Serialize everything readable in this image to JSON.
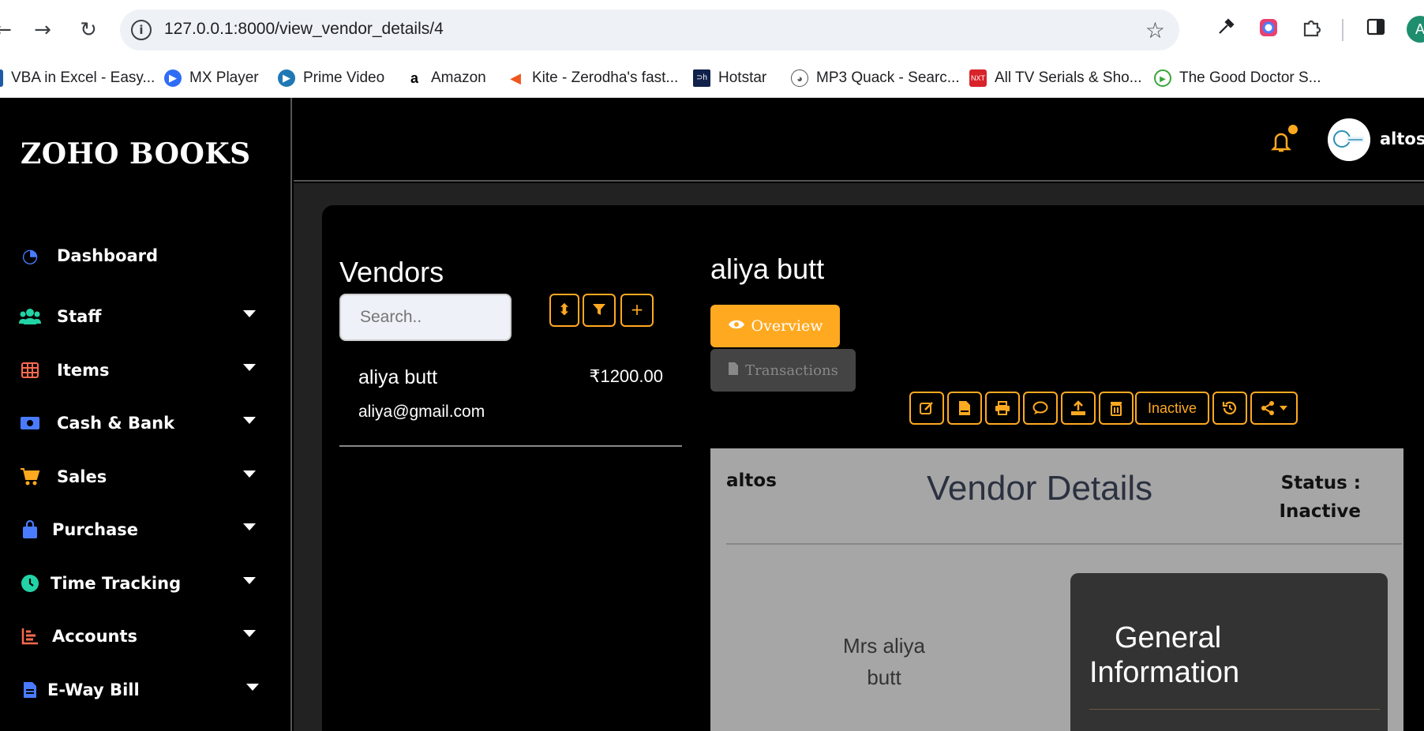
{
  "browser": {
    "url": "127.0.0.1:8000/view_vendor_details/4",
    "bookmarks": [
      {
        "label": "VBA in Excel - Easy...",
        "color": "#1f5aa6"
      },
      {
        "label": "MX Player",
        "color": "#2f6df6"
      },
      {
        "label": "Prime Video",
        "color": "#1f78b4"
      },
      {
        "label": "Amazon",
        "color": "#000000"
      },
      {
        "label": "Kite - Zerodha's fast...",
        "color": "#f0561d"
      },
      {
        "label": "Hotstar",
        "color": "#10214a"
      },
      {
        "label": "MP3 Quack - Searc...",
        "color": "#888888"
      },
      {
        "label": "All TV Serials & Sho...",
        "color": "#d8232a"
      },
      {
        "label": "The Good Doctor S...",
        "color": "#3aa53a"
      }
    ],
    "profile_initial": "A"
  },
  "sidebar": {
    "brand": "ZOHO BOOKS",
    "items": [
      {
        "label": "Dashboard",
        "icon": "gauge-icon",
        "color": "#4a7bff"
      },
      {
        "label": "Staff",
        "icon": "users-icon",
        "color": "#22d3a6"
      },
      {
        "label": "Items",
        "icon": "table-icon",
        "color": "#ff6a4d"
      },
      {
        "label": "Cash & Bank",
        "icon": "money-icon",
        "color": "#4a7bff"
      },
      {
        "label": "Sales",
        "icon": "cart-icon",
        "color": "#ffa920"
      },
      {
        "label": "Purchase",
        "icon": "bag-icon",
        "color": "#4a7bff"
      },
      {
        "label": "Time Tracking",
        "icon": "clock-icon",
        "color": "#22d3a6"
      },
      {
        "label": "Accounts",
        "icon": "chart-icon",
        "color": "#ff6a4d"
      },
      {
        "label": "E-Way Bill",
        "icon": "file-icon",
        "color": "#4a7bff"
      }
    ]
  },
  "topbar": {
    "user_name": "altos",
    "accent": "#ffa920"
  },
  "vendors": {
    "title": "Vendors",
    "search_placeholder": "Search..",
    "list": [
      {
        "name": "aliya butt",
        "amount": "₹1200.00",
        "email": "aliya@gmail.com"
      }
    ]
  },
  "detail": {
    "name": "aliya butt",
    "overview_label": "Overview",
    "transactions_label": "Transactions",
    "inactive_label": "Inactive",
    "card": {
      "company": "altos",
      "title": "Vendor Details",
      "status_label": "Status :",
      "status_value": "Inactive",
      "person_line1": "Mrs aliya",
      "person_line2": "butt",
      "general_line1": "General",
      "general_line2": "Information"
    }
  }
}
